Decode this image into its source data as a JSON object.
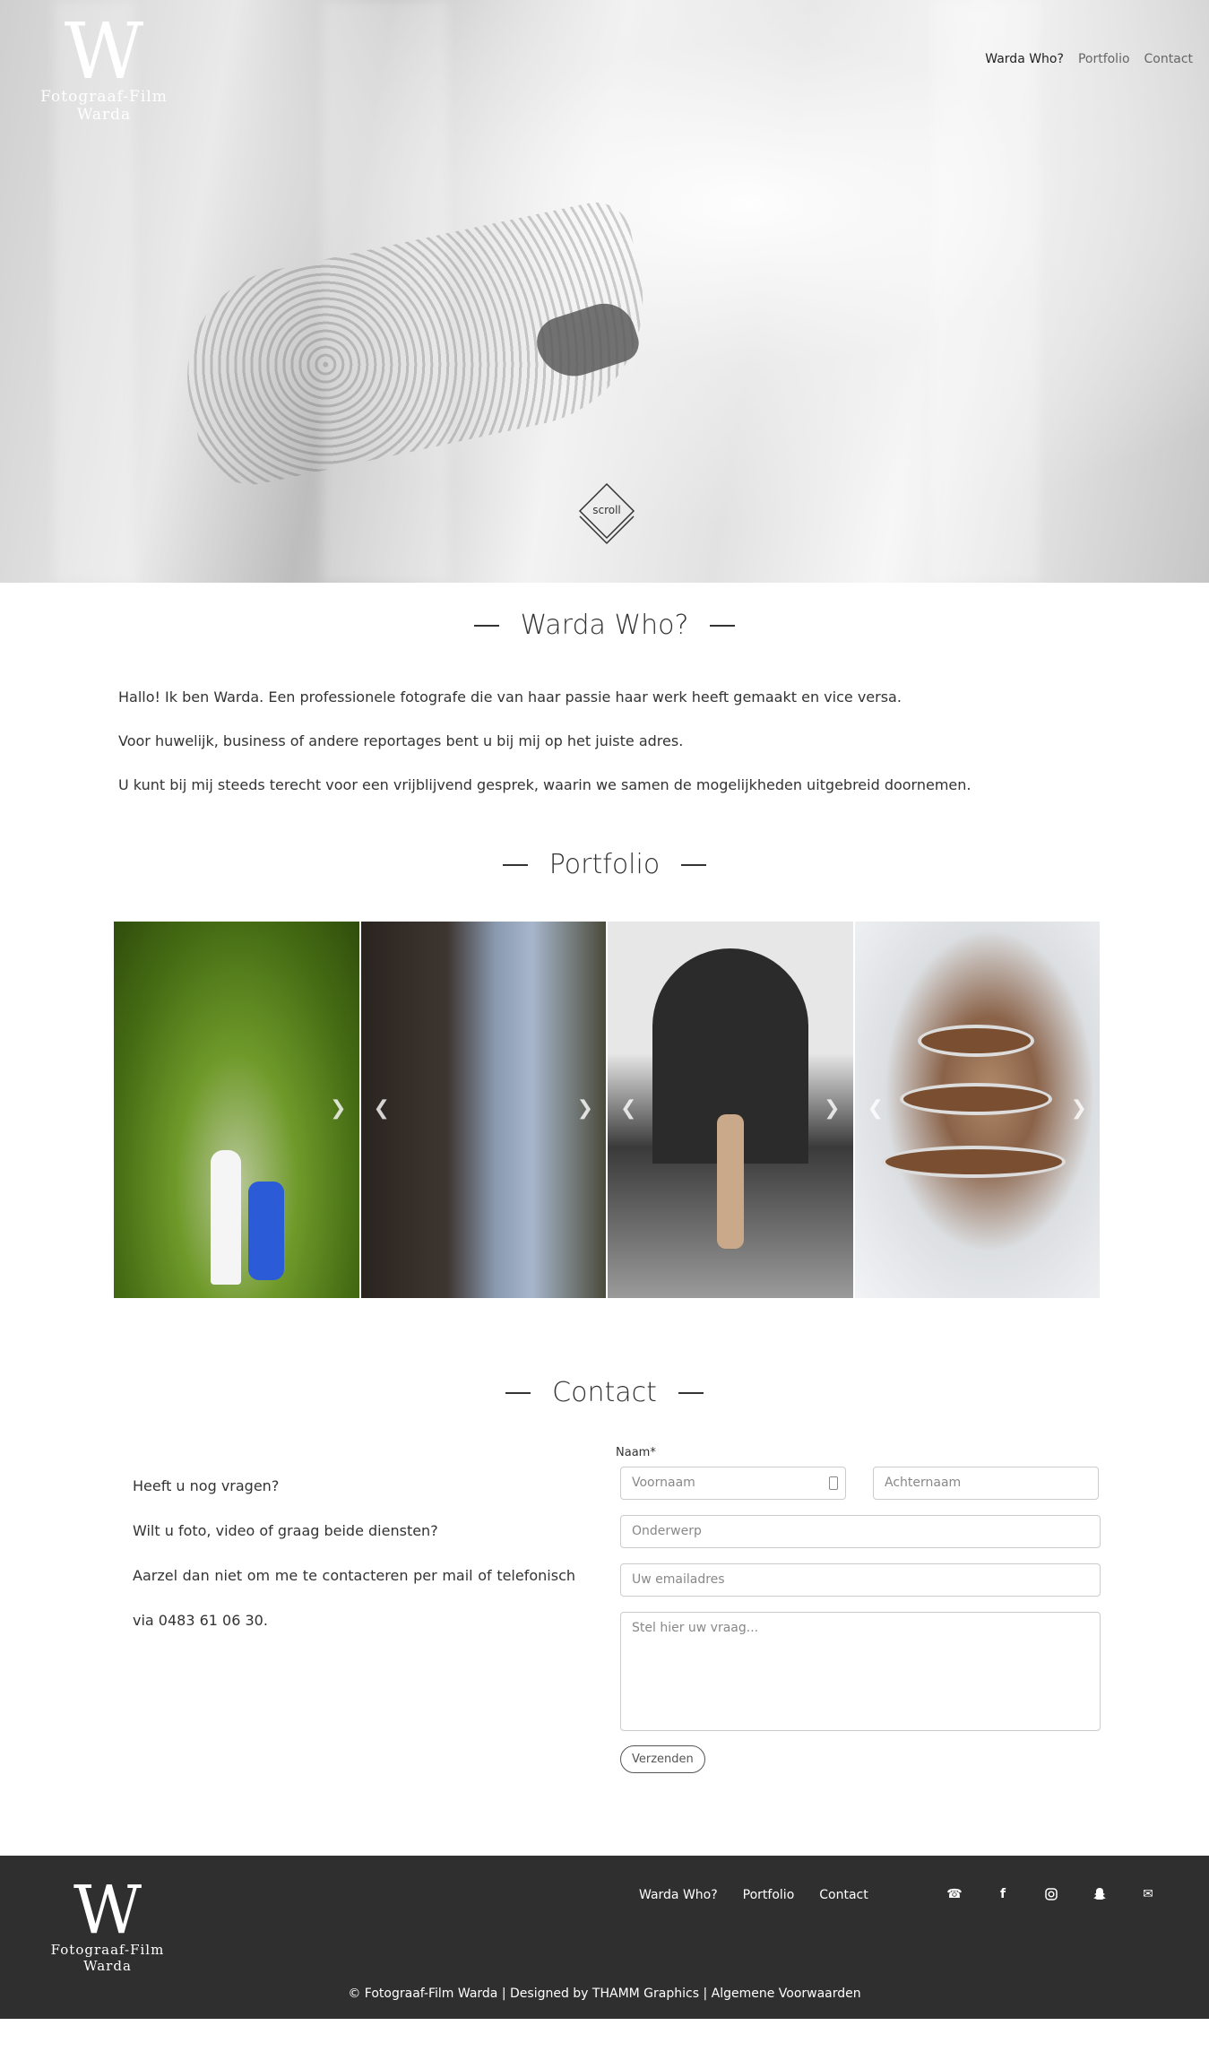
{
  "brand": {
    "mark": "W",
    "name": "Fotograaf-Film Warda"
  },
  "nav": {
    "items": [
      "Warda Who?",
      "Portfolio",
      "Contact"
    ],
    "active": "Warda Who?"
  },
  "hero": {
    "scroll_label": "scroll"
  },
  "who": {
    "title": "Warda Who?",
    "paragraphs": [
      "Hallo! Ik ben Warda. Een professionele fotografe die van haar passie haar werk heeft gemaakt en vice versa.",
      "Voor huwelijk, business of andere reportages bent u bij mij op het juiste adres.",
      "U kunt bij mij steeds terecht voor een vrijblijvend gesprek, waarin we samen de mogelijkheden uitgebreid doornemen."
    ]
  },
  "portfolio": {
    "title": "Portfolio"
  },
  "contact": {
    "title": "Contact",
    "text": [
      "Heeft u nog vragen?",
      "Wilt u foto, video of graag beide diensten?",
      "Aarzel dan niet om me te contacteren per mail of telefonisch via 0483 61 06 30."
    ],
    "form": {
      "name_label": "Naam*",
      "firstname_placeholder": "Voornaam",
      "lastname_placeholder": "Achternaam",
      "subject_placeholder": "Onderwerp",
      "email_placeholder": "Uw emailadres",
      "message_placeholder": "Stel hier uw vraag...",
      "submit_label": "Verzenden"
    }
  },
  "footer": {
    "nav": [
      "Warda Who?",
      "Portfolio",
      "Contact"
    ],
    "social_icons": [
      "phone-icon",
      "facebook-icon",
      "instagram-icon",
      "snapchat-icon",
      "mail-icon"
    ],
    "copyright": "© Fotograaf-Film Warda | Designed by THAMM Graphics | Algemene Voorwaarden"
  },
  "colors": {
    "footer_bg": "#2f2f2f",
    "text": "#333333"
  }
}
